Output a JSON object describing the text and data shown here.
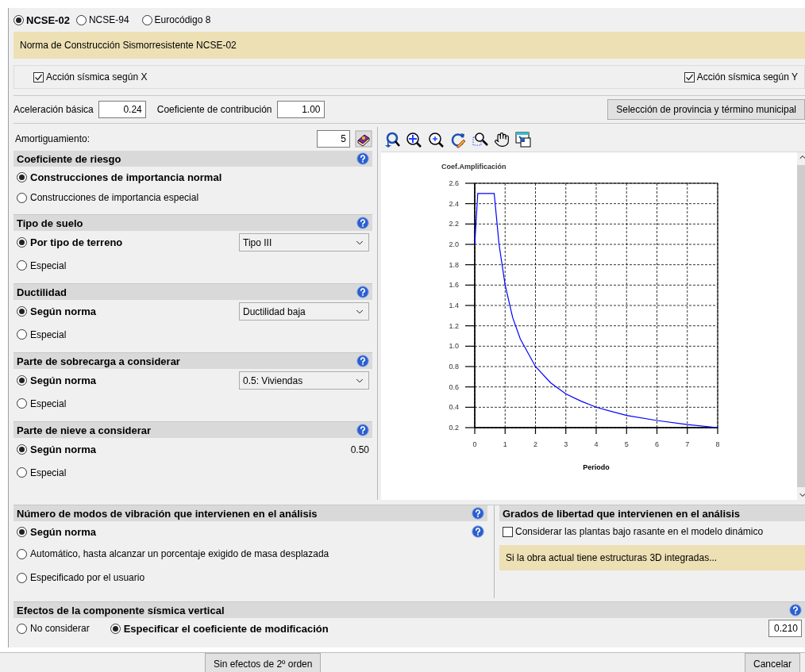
{
  "norms": [
    {
      "label": "NCSE-02",
      "selected": true
    },
    {
      "label": "NCSE-94",
      "selected": false
    },
    {
      "label": "Eurocódigo 8",
      "selected": false
    }
  ],
  "norm_description": "Norma de Construcción Sismorresistente NCSE-02",
  "seismic_x": {
    "label": "Acción sísmica según X",
    "checked": true
  },
  "seismic_y": {
    "label": "Acción sísmica según Y",
    "checked": true
  },
  "basic_acceleration": {
    "label": "Aceleración básica",
    "value": "0.24"
  },
  "contribution_coefficient": {
    "label": "Coeficiente de contribución",
    "value": "1.00"
  },
  "province_button": "Selección de provincia y término municipal",
  "damping": {
    "label": "Amortiguamiento:",
    "value": "5"
  },
  "sections": [
    {
      "title": "Coeficiente de riesgo",
      "options": [
        {
          "kind": "plain",
          "label": "Construcciones de importancia normal",
          "selected": true
        },
        {
          "kind": "plain",
          "label": "Construcciones de importancia especial",
          "selected": false
        }
      ]
    },
    {
      "title": "Tipo de suelo",
      "options": [
        {
          "kind": "select",
          "label": "Por tipo de terreno",
          "selected": true,
          "value": "Tipo III"
        },
        {
          "kind": "plain",
          "label": "Especial",
          "selected": false
        }
      ]
    },
    {
      "title": "Ductilidad",
      "options": [
        {
          "kind": "select",
          "label": "Según norma",
          "selected": true,
          "value": "Ductilidad baja"
        },
        {
          "kind": "plain",
          "label": "Especial",
          "selected": false
        }
      ]
    },
    {
      "title": "Parte de sobrecarga a considerar",
      "options": [
        {
          "kind": "select",
          "label": "Según norma",
          "selected": true,
          "value": "0.5: Viviendas"
        },
        {
          "kind": "plain",
          "label": "Especial",
          "selected": false
        }
      ]
    },
    {
      "title": "Parte de nieve a considerar",
      "options": [
        {
          "kind": "value",
          "label": "Según norma",
          "selected": true,
          "value": "0.50"
        },
        {
          "kind": "plain",
          "label": "Especial",
          "selected": false
        }
      ]
    }
  ],
  "chart_data": {
    "type": "line",
    "title": "Coef.Amplificación",
    "xlabel": "Periodo",
    "x": [
      0,
      0.1,
      0.64,
      0.8,
      1,
      1.25,
      1.5,
      2,
      2.5,
      3,
      3.5,
      4,
      5,
      6,
      7,
      8
    ],
    "grid": true,
    "series": [
      {
        "color": "#0000ff",
        "values": [
          2.0,
          2.5,
          2.5,
          2.0,
          1.6,
          1.28,
          1.07,
          0.8,
          0.64,
          0.53,
          0.46,
          0.4,
          0.32,
          0.27,
          0.23,
          0.2
        ]
      }
    ],
    "xlim": [
      0,
      8
    ],
    "ylim": [
      0.2,
      2.6
    ],
    "xticks": [
      0,
      1,
      2,
      3,
      4,
      5,
      6,
      7,
      8
    ],
    "yticks": [
      {
        "value": 0.2,
        "label": "0.2"
      },
      {
        "value": 0.4,
        "label": "0.4"
      },
      {
        "value": 0.6,
        "label": "0.6"
      },
      {
        "value": 0.8,
        "label": "0.8"
      },
      {
        "value": 1.0,
        "label": "1.0"
      },
      {
        "value": 1.2,
        "label": "1.2"
      },
      {
        "value": 1.4,
        "label": "1.4"
      },
      {
        "value": 1.6,
        "label": "1.6"
      },
      {
        "value": 1.8,
        "label": "1.8"
      },
      {
        "value": 2.0,
        "label": "2.0"
      },
      {
        "value": 2.2,
        "label": "2.2"
      },
      {
        "value": 2.4,
        "label": "2.4"
      },
      {
        "value": 2.6,
        "label": "2.6"
      }
    ]
  },
  "vibration_modes": {
    "title": "Número de modos de vibración que intervienen en el análisis",
    "options": [
      {
        "kind": "help",
        "label": "Según norma",
        "selected": true
      },
      {
        "kind": "plain",
        "label": "Automático, hasta alcanzar un porcentaje exigido de masa desplazada",
        "selected": false
      },
      {
        "kind": "plain",
        "label": "Especificado por el usuario",
        "selected": false
      }
    ]
  },
  "degrees_of_freedom": {
    "title": "Grados de libertad que intervienen en el análisis",
    "checkbox": {
      "label": "Considerar las plantas bajo rasante en el modelo dinámico",
      "checked": false
    },
    "note": "Si la obra actual tiene estructuras 3D integradas..."
  },
  "vertical_component": {
    "title": "Efectos de la componente sísmica vertical",
    "options": [
      {
        "label": "No considerar",
        "selected": false
      },
      {
        "label": "Especificar el coeficiente de modificación",
        "selected": true
      }
    ],
    "value": "0.210"
  },
  "footer_buttons": [
    "Sin efectos de 2º orden",
    "Cancelar"
  ]
}
